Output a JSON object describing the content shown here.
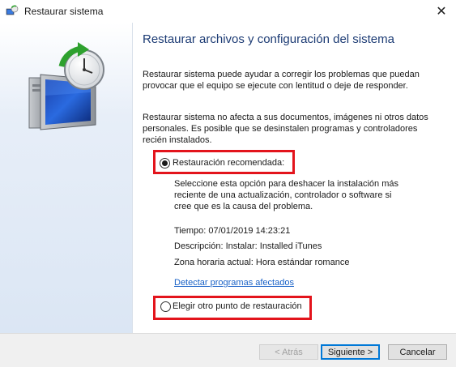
{
  "window": {
    "title": "Restaurar sistema",
    "close_glyph": "✕"
  },
  "page": {
    "heading": "Restaurar archivos y configuración del sistema",
    "intro": "Restaurar sistema puede ayudar a corregir los problemas que puedan provocar que el equipo se ejecute con lentitud o deje de responder.",
    "note": "Restaurar sistema no afecta a sus documentos, imágenes ni otros datos personales. Es posible que se desinstalen programas y controladores recién instalados."
  },
  "options": {
    "recommended": {
      "label": "Restauración recomendada:",
      "selected": true,
      "description": "Seleccione esta opción para deshacer la instalación más reciente de una actualización, controlador o software si cree que es la causa del problema.",
      "time": "Tiempo: 07/01/2019 14:23:21",
      "description_line": "Descripción: Instalar: Installed iTunes",
      "timezone": "Zona horaria actual: Hora estándar romance",
      "affected_link": "Detectar programas afectados"
    },
    "other": {
      "label": "Elegir otro punto de restauración",
      "selected": false
    }
  },
  "footer": {
    "back_label": "< Atrás",
    "next_label": "Siguiente >",
    "cancel_label": "Cancelar"
  },
  "colors": {
    "heading": "#1c3b74",
    "highlight": "#e3141c",
    "link": "#1a62c7"
  }
}
